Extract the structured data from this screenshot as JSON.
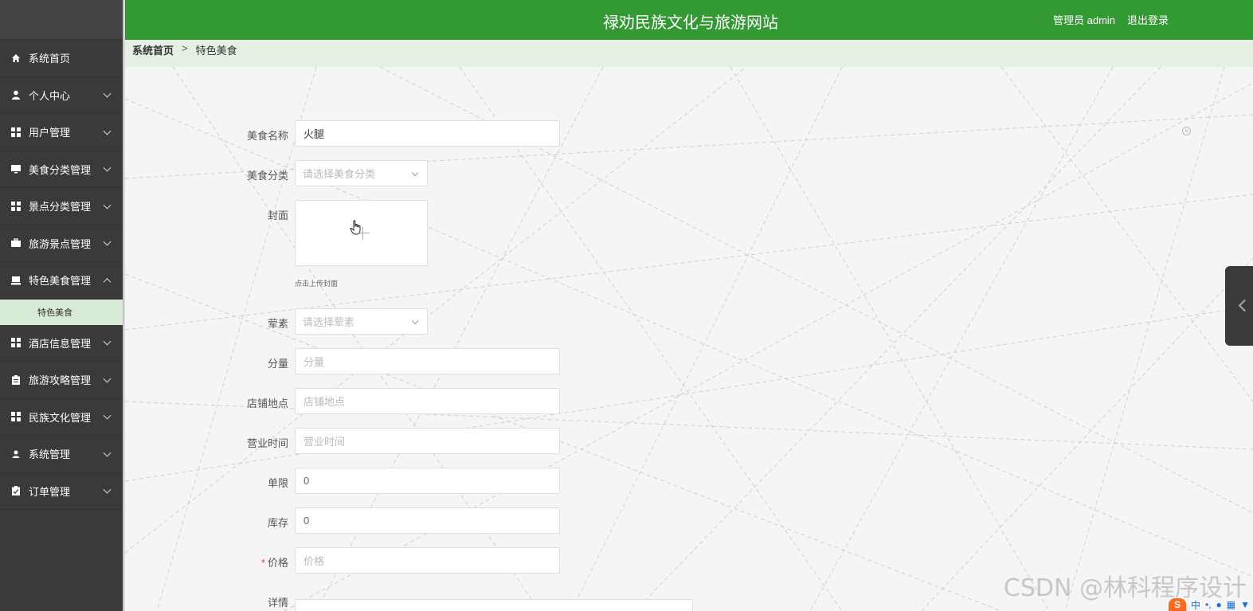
{
  "header": {
    "title": "禄劝民族文化与旅游网站",
    "user_label": "管理员 admin",
    "logout_label": "退出登录"
  },
  "sidebar": {
    "items": [
      {
        "label": "系统首页",
        "icon": "home-icon",
        "has_arrow": false
      },
      {
        "label": "个人中心",
        "icon": "person-icon",
        "has_arrow": true
      },
      {
        "label": "用户管理",
        "icon": "grid-icon",
        "has_arrow": true
      },
      {
        "label": "美食分类管理",
        "icon": "monitor-icon",
        "has_arrow": true
      },
      {
        "label": "景点分类管理",
        "icon": "grid-icon",
        "has_arrow": true
      },
      {
        "label": "旅游景点管理",
        "icon": "briefcase-icon",
        "has_arrow": true
      },
      {
        "label": "特色美食管理",
        "icon": "inbox-icon",
        "has_arrow": true,
        "expanded": true
      },
      {
        "label": "酒店信息管理",
        "icon": "grid-icon",
        "has_arrow": true
      },
      {
        "label": "旅游攻略管理",
        "icon": "clipboard-icon",
        "has_arrow": true
      },
      {
        "label": "民族文化管理",
        "icon": "grid-icon",
        "has_arrow": true
      },
      {
        "label": "系统管理",
        "icon": "user-icon",
        "has_arrow": true
      },
      {
        "label": "订单管理",
        "icon": "clipboard-check-icon",
        "has_arrow": true
      }
    ],
    "submenu": {
      "label": "特色美食"
    }
  },
  "breadcrumb": {
    "home": "系统首页",
    "separator": ">",
    "current": "特色美食"
  },
  "form": {
    "name": {
      "label": "美食名称",
      "value": "火腿"
    },
    "category": {
      "label": "美食分类",
      "placeholder": "请选择美食分类"
    },
    "cover": {
      "label": "封面",
      "hint": "点击上传封面"
    },
    "diet": {
      "label": "荤素",
      "placeholder": "请选择荤素"
    },
    "portion": {
      "label": "分量",
      "placeholder": "分量"
    },
    "store": {
      "label": "店铺地点",
      "placeholder": "店铺地点"
    },
    "hours": {
      "label": "营业时间",
      "placeholder": "营业时间"
    },
    "limit": {
      "label": "单限",
      "value": "0"
    },
    "stock": {
      "label": "库存",
      "value": "0"
    },
    "price": {
      "label": "价格",
      "required_mark": "*",
      "placeholder": "价格"
    },
    "details": {
      "label": "详情"
    }
  },
  "watermark": "CSDN @林科程序设计",
  "ime": {
    "logo": "S",
    "lang": "中"
  },
  "colors": {
    "header_bg": "#339933",
    "sidebar_bg": "#3a3a3a",
    "submenu_bg": "#d8ebd6",
    "breadcrumb_bg": "#e6efe4",
    "required": "#e64242"
  }
}
